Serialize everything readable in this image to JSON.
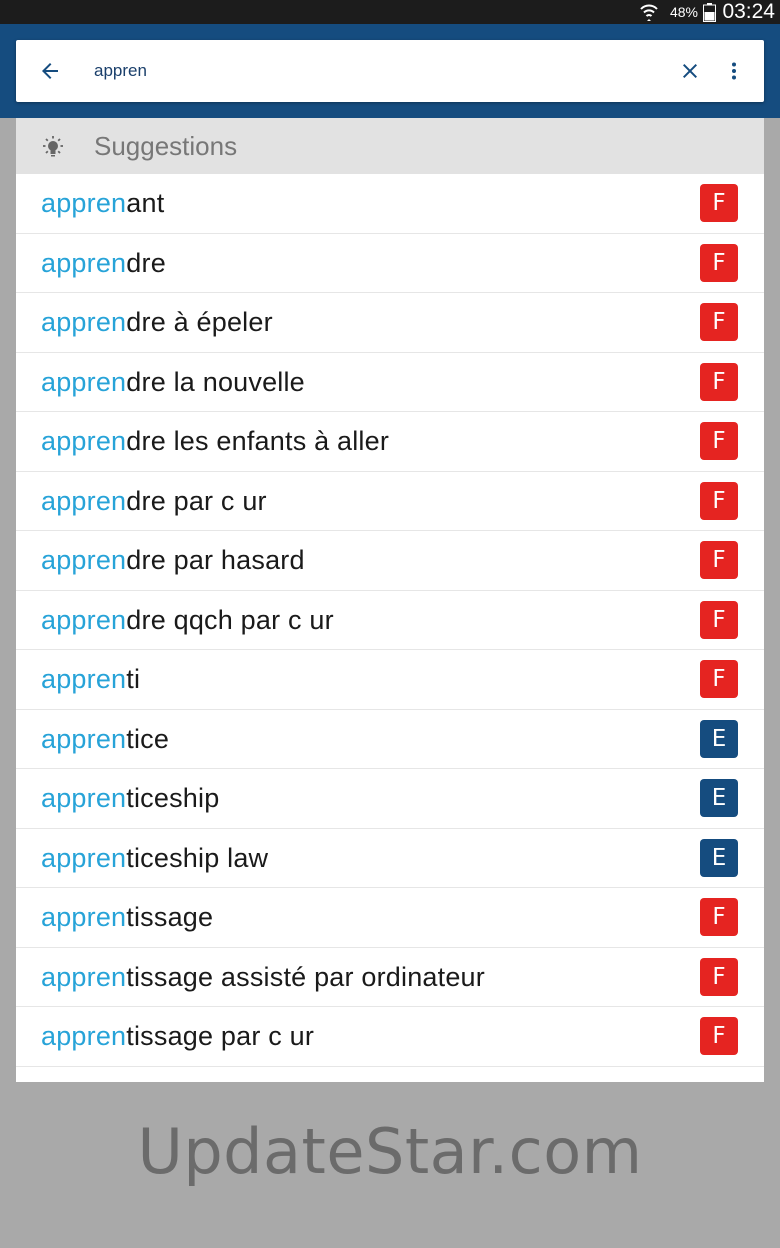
{
  "status_bar": {
    "battery_percent": "48%",
    "time": "03:24"
  },
  "search": {
    "query": "appren",
    "back_icon": "arrow-left-icon",
    "clear_icon": "close-icon",
    "menu_icon": "more-vert-icon"
  },
  "suggestions": {
    "title": "Suggestions",
    "icon": "lightbulb-icon",
    "items": [
      {
        "match": "appren",
        "rest": "ant",
        "lang": "F"
      },
      {
        "match": "appren",
        "rest": "dre",
        "lang": "F"
      },
      {
        "match": "appren",
        "rest": "dre à épeler",
        "lang": "F"
      },
      {
        "match": "appren",
        "rest": "dre la nouvelle",
        "lang": "F"
      },
      {
        "match": "appren",
        "rest": "dre les enfants à aller",
        "lang": "F"
      },
      {
        "match": "appren",
        "rest": "dre par c ur",
        "lang": "F"
      },
      {
        "match": "appren",
        "rest": "dre par hasard",
        "lang": "F"
      },
      {
        "match": "appren",
        "rest": "dre qqch par c ur",
        "lang": "F"
      },
      {
        "match": "appren",
        "rest": "ti",
        "lang": "F"
      },
      {
        "match": "appren",
        "rest": "tice",
        "lang": "E"
      },
      {
        "match": "appren",
        "rest": "ticeship",
        "lang": "E"
      },
      {
        "match": "appren",
        "rest": "ticeship law",
        "lang": "E"
      },
      {
        "match": "appren",
        "rest": "tissage",
        "lang": "F"
      },
      {
        "match": "appren",
        "rest": "tissage assisté par ordinateur",
        "lang": "F"
      },
      {
        "match": "appren",
        "rest": "tissage par c ur",
        "lang": "F"
      }
    ]
  },
  "colors": {
    "header": "#154c7f",
    "match_text": "#27a3d8",
    "badge_french": "#e52421",
    "badge_english": "#154c7f"
  },
  "watermark": "UpdateStar.com"
}
